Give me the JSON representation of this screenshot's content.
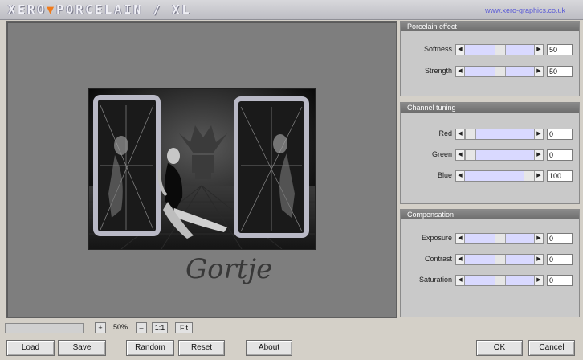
{
  "app": {
    "logo_left": "XERO",
    "logo_mark": "▼",
    "logo_right": "PORCELAIN / XL",
    "website": "www.xero-graphics.co.uk"
  },
  "preview": {
    "signature": "Gortje"
  },
  "panels": [
    {
      "title": "Porcelain effect",
      "controls": [
        {
          "label": "Softness",
          "value": "50",
          "level": 0.5
        },
        {
          "label": "Strength",
          "value": "50",
          "level": 0.5
        }
      ]
    },
    {
      "title": "Channel tuning",
      "controls": [
        {
          "label": "Red",
          "value": "0",
          "level": 0
        },
        {
          "label": "Green",
          "value": "0",
          "level": 0
        },
        {
          "label": "Blue",
          "value": "100",
          "level": 1
        }
      ]
    },
    {
      "title": "Compensation",
      "controls": [
        {
          "label": "Exposure",
          "value": "0",
          "level": 0.5
        },
        {
          "label": "Contrast",
          "value": "0",
          "level": 0.5
        },
        {
          "label": "Saturation",
          "value": "0",
          "level": 0.5
        }
      ]
    }
  ],
  "zoom": {
    "plus": "+",
    "value": "50%",
    "minus": "–",
    "one_to_one": "1:1",
    "fit": "Fit"
  },
  "buttons": {
    "load": "Load",
    "save": "Save",
    "random": "Random",
    "reset": "Reset",
    "about": "About",
    "ok": "OK",
    "cancel": "Cancel"
  }
}
